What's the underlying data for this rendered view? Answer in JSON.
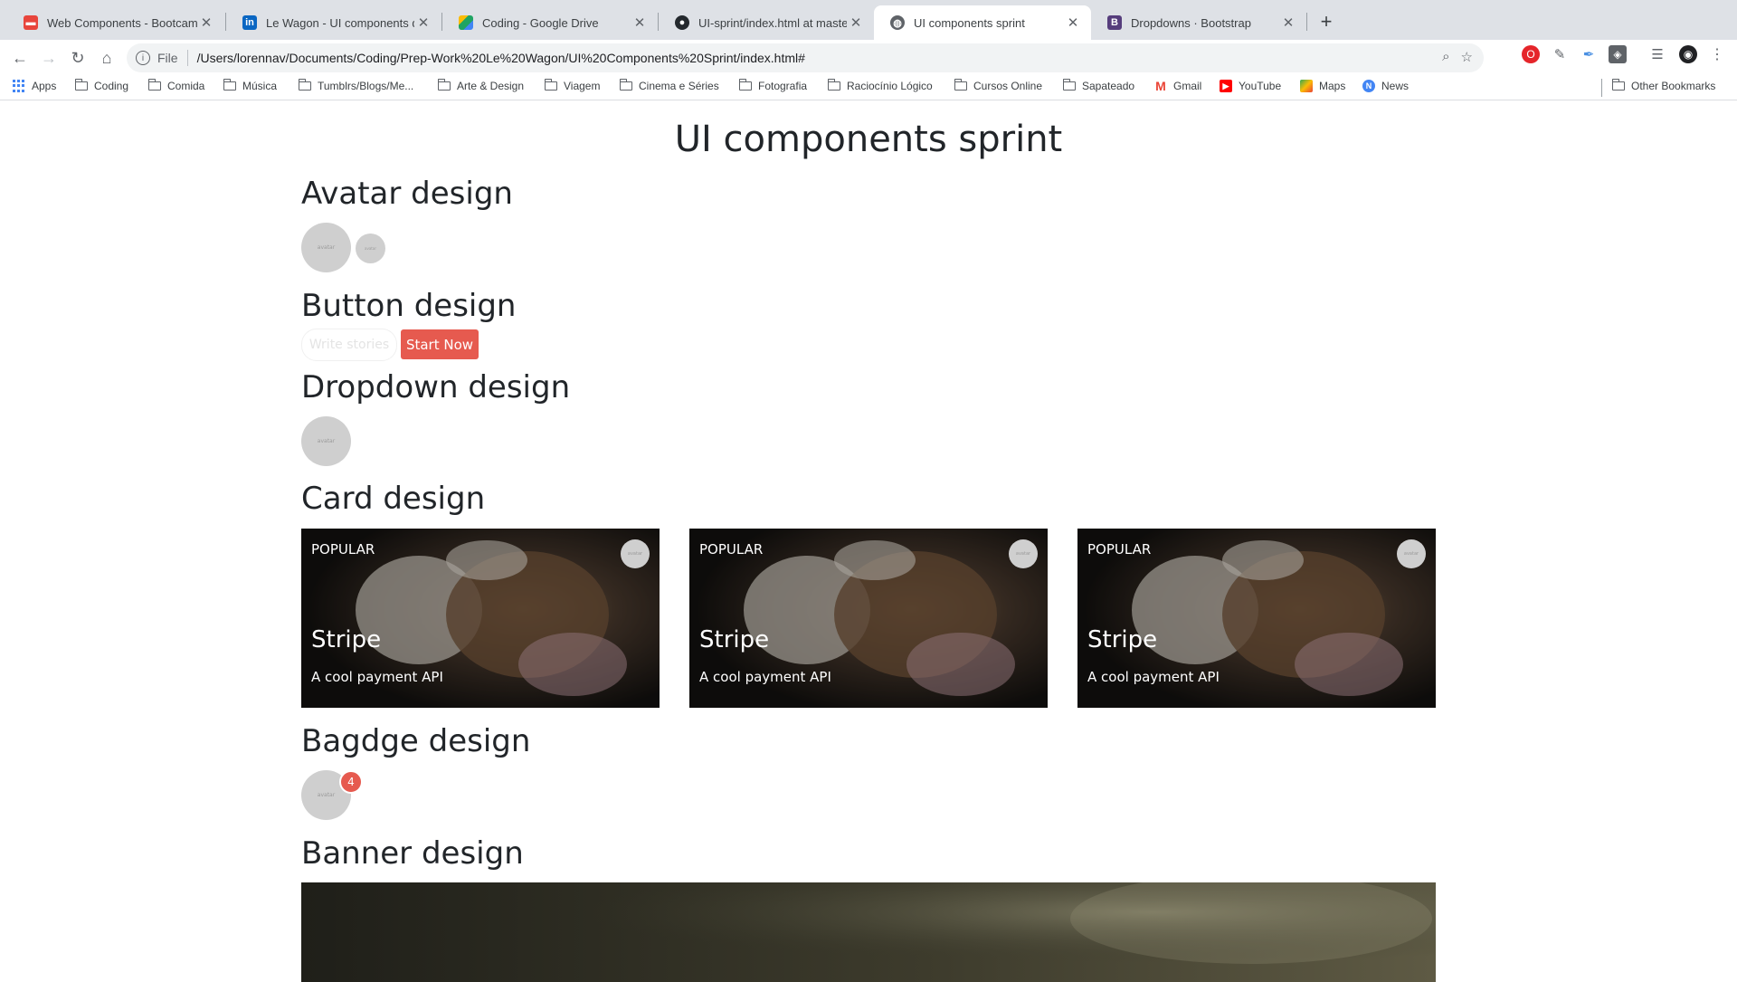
{
  "browser": {
    "tabs": [
      {
        "title": "Web Components - Bootcamp",
        "icon": "bus-favicon-icon",
        "color": "#e8453c"
      },
      {
        "title": "Le Wagon - UI components de",
        "icon": "linkedin-icon",
        "color": "#0a66c2"
      },
      {
        "title": "Coding - Google Drive",
        "icon": "google-drive-icon",
        "color": "#1fa463"
      },
      {
        "title": "UI-sprint/index.html at master",
        "icon": "github-icon",
        "color": "#24292e"
      },
      {
        "title": "UI components sprint",
        "icon": "globe-icon",
        "color": "#5f6368",
        "active": true
      },
      {
        "title": "Dropdowns · Bootstrap",
        "icon": "bootstrap-icon",
        "color": "#563d7c"
      }
    ],
    "omnibox": {
      "scheme": "File",
      "url": "/Users/lorennav/Documents/Coding/Prep-Work%20Le%20Wagon/UI%20Components%20Sprint/index.html#"
    },
    "bookmarks": [
      {
        "label": "Apps",
        "icon": "apps-grid-icon"
      },
      {
        "label": "Coding",
        "icon": "folder-icon"
      },
      {
        "label": "Comida",
        "icon": "folder-icon"
      },
      {
        "label": "Música",
        "icon": "folder-icon"
      },
      {
        "label": "Tumblrs/Blogs/Me...",
        "icon": "folder-icon"
      },
      {
        "label": "Arte & Design",
        "icon": "folder-icon"
      },
      {
        "label": "Viagem",
        "icon": "folder-icon"
      },
      {
        "label": "Cinema e Séries",
        "icon": "folder-icon"
      },
      {
        "label": "Fotografia",
        "icon": "folder-icon"
      },
      {
        "label": "Raciocínio Lógico",
        "icon": "folder-icon"
      },
      {
        "label": "Cursos Online",
        "icon": "folder-icon"
      },
      {
        "label": "Sapateado",
        "icon": "folder-icon"
      },
      {
        "label": "Gmail",
        "icon": "gmail-icon"
      },
      {
        "label": "YouTube",
        "icon": "youtube-icon"
      },
      {
        "label": "Maps",
        "icon": "maps-icon"
      },
      {
        "label": "News",
        "icon": "news-icon"
      }
    ],
    "other_bookmarks": "Other Bookmarks"
  },
  "page": {
    "title": "UI components sprint",
    "sections": {
      "avatar": "Avatar design",
      "button": "Button design",
      "dropdown": "Dropdown design",
      "card": "Card design",
      "badge": "Bagdge design",
      "banner": "Banner design"
    },
    "avatar_alt": "avatar",
    "buttons": {
      "ghost": "Write stories",
      "primary": "Start Now"
    },
    "cards": [
      {
        "tag": "POPULAR",
        "title": "Stripe",
        "subtitle": "A cool payment API"
      },
      {
        "tag": "POPULAR",
        "title": "Stripe",
        "subtitle": "A cool payment API"
      },
      {
        "tag": "POPULAR",
        "title": "Stripe",
        "subtitle": "A cool payment API"
      }
    ],
    "badge_count": "4",
    "accent_color": "#e65a4f"
  }
}
